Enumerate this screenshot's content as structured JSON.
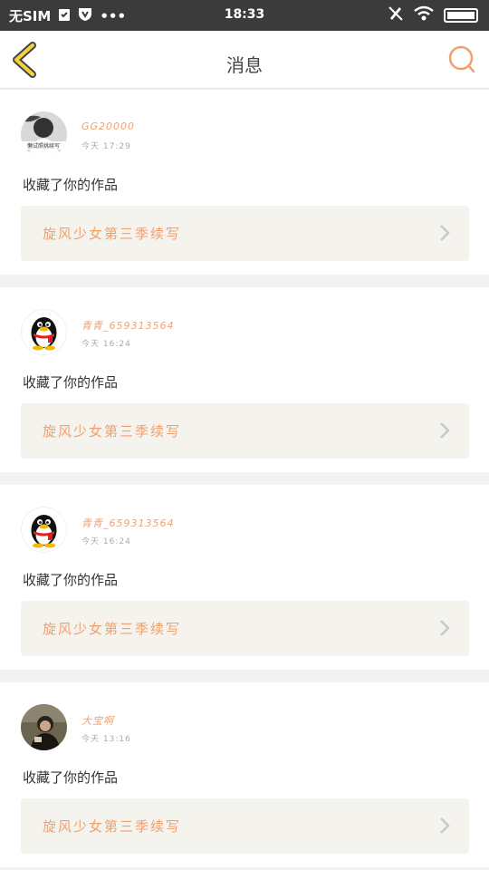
{
  "status_bar": {
    "carrier": "无SIM",
    "dots": "•••",
    "time": "18:33"
  },
  "header": {
    "title": "消息",
    "accent_color": "#f0a06e",
    "back_color": "#f5d33a"
  },
  "messages": [
    {
      "user": "GG20000",
      "time": "今天 17:29",
      "action": "收藏了你的作品",
      "work": "旋风少女第三季续写",
      "avatar_caption": "懒试照挑续写"
    },
    {
      "user": "青青_659313564",
      "time": "今天 16:24",
      "action": "收藏了你的作品",
      "work": "旋风少女第三季续写"
    },
    {
      "user": "青青_659313564",
      "time": "今天 16:24",
      "action": "收藏了你的作品",
      "work": "旋风少女第三季续写"
    },
    {
      "user": "大宝啊",
      "time": "今天 13:16",
      "action": "收藏了你的作品",
      "work": "旋风少女第三季续写"
    }
  ]
}
